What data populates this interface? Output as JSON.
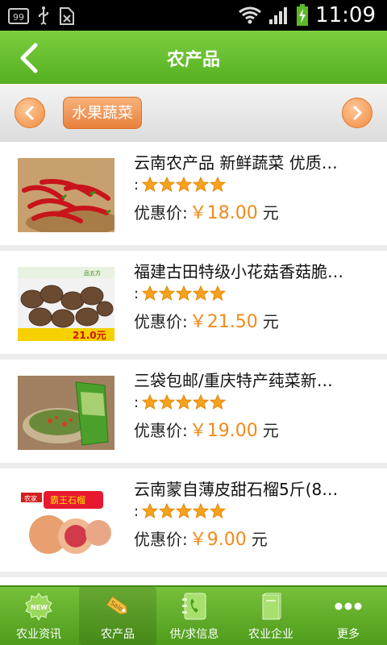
{
  "status_bar": {
    "notif_badge": "99",
    "time": "11:09",
    "icons": [
      "notification-99-icon",
      "usb-icon",
      "no-sim-icon",
      "wifi-icon",
      "signal-icon",
      "battery-charging-icon"
    ]
  },
  "header": {
    "title": "农产品"
  },
  "category_bar": {
    "current": "水果蔬菜"
  },
  "products": [
    {
      "title": "云南农产品 新鲜蔬菜 优质…",
      "rating_prefix": ":",
      "rating": 5,
      "price_label": "优惠价:",
      "price": "￥18.00",
      "unit": "元",
      "image": "red-chili-peppers"
    },
    {
      "title": "福建古田特级小花菇香菇脆…",
      "rating_prefix": ":",
      "rating": 5,
      "price_label": "优惠价:",
      "price": "￥21.50",
      "unit": "元",
      "image": "dried-shiitake-mushrooms",
      "image_text": {
        "brand": "品五方",
        "price_tag": "21.0元"
      }
    },
    {
      "title": " 三袋包邮/重庆特产莼菜新…",
      "rating_prefix": ":",
      "rating": 5,
      "price_label": "优惠价:",
      "price": "￥19.00",
      "unit": "元",
      "image": "pickled-vegetables-bag"
    },
    {
      "title": "云南蒙自薄皮甜石榴5斤(8…",
      "rating_prefix": ":",
      "rating": 5,
      "price_label": "优惠价:",
      "price": "￥9.00",
      "unit": "元",
      "image": "pomegranates",
      "image_text": {
        "badge": "农家",
        "banner": "霸王石榴"
      }
    }
  ],
  "tabs": [
    {
      "label": "农业资讯",
      "icon": "new-badge-icon",
      "active": false
    },
    {
      "label": "农产品",
      "icon": "sale-tag-icon",
      "active": true
    },
    {
      "label": "供/求信息",
      "icon": "phone-book-icon",
      "active": false
    },
    {
      "label": "农业企业",
      "icon": "book-icon",
      "active": false
    },
    {
      "label": "更多",
      "icon": "more-dots-icon",
      "active": false
    }
  ],
  "colors": {
    "brand_green": "#5bb427",
    "accent_orange": "#f18a1a",
    "star": "#f7a21b"
  }
}
